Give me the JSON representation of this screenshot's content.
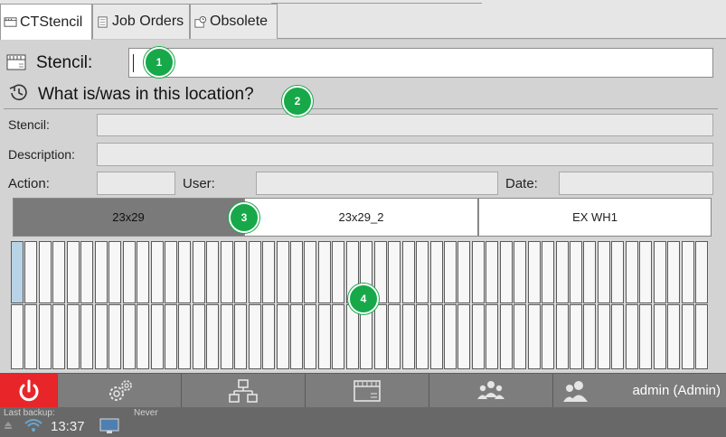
{
  "tabs": [
    {
      "label": "CTStencil",
      "active": true,
      "icon": "stencil-icon"
    },
    {
      "label": "Job Orders",
      "active": false,
      "icon": "document-icon"
    },
    {
      "label": "Obsolete",
      "active": false,
      "icon": "obsolete-icon"
    }
  ],
  "scan": {
    "label": "Stencil:",
    "value": ""
  },
  "history": {
    "title": "What is/was in this location?"
  },
  "fields": {
    "stencil_label": "Stencil:",
    "description_label": "Description:",
    "action_label": "Action:",
    "user_label": "User:",
    "date_label": "Date:",
    "stencil_value": "",
    "description_value": "",
    "action_value": "",
    "user_value": "",
    "date_value": ""
  },
  "locations": [
    {
      "label": "23x29",
      "active": true
    },
    {
      "label": "23x29_2",
      "active": false
    },
    {
      "label": "EX WH1",
      "active": false
    }
  ],
  "grid": {
    "columns": 50,
    "rows": 2,
    "selected": [
      0
    ]
  },
  "badges": [
    "1",
    "2",
    "3",
    "4"
  ],
  "toolbar": {
    "user": "admin (Admin)",
    "buttons": [
      "power-icon",
      "settings-icon",
      "network-icon",
      "stencil-icon",
      "group-icon",
      "users-icon"
    ]
  },
  "status": {
    "last_backup_label": "Last backup:",
    "last_backup_value": "Never",
    "time": "13:37"
  },
  "colors": {
    "accent_green": "#17a84a",
    "power_red": "#e8262a",
    "selected_slot": "#b8d3e6"
  }
}
